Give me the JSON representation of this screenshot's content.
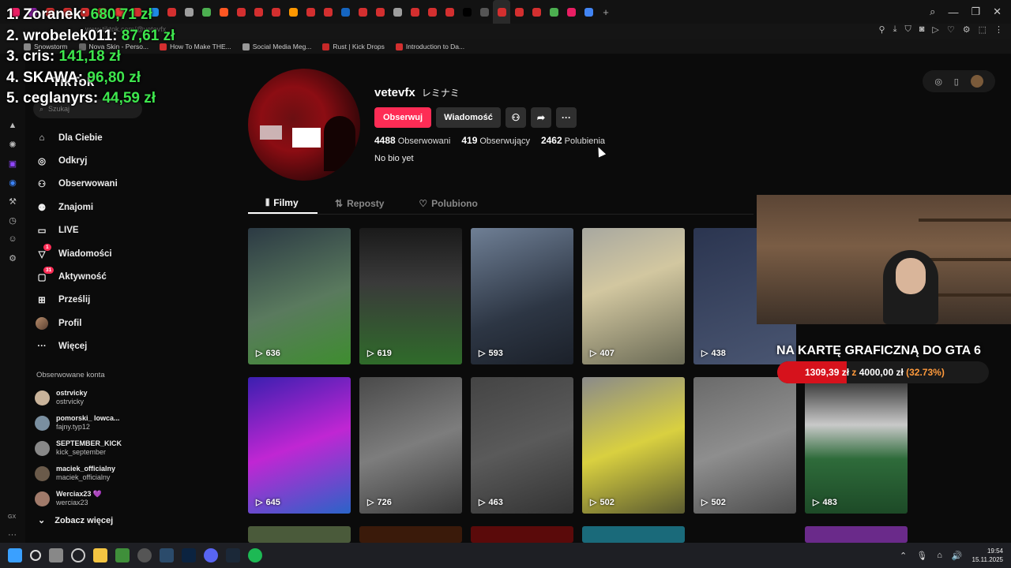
{
  "browser": {
    "url": "www.tiktok.com/@vetevfx",
    "tab_icon_colors": [
      "#e91e63",
      "#8e24aa",
      "#d32f2f",
      "#d32f2f",
      "#d32f2f",
      "#e53935",
      "#e53935",
      "#d32f2f",
      "#1e88e5",
      "#d32f2f",
      "#9e9e9e",
      "#4caf50",
      "#ff5722",
      "#d32f2f",
      "#d32f2f",
      "#d32f2f",
      "#ff9800",
      "#d32f2f",
      "#d32f2f",
      "#1565c0",
      "#d32f2f",
      "#d32f2f",
      "#9e9e9e",
      "#d32f2f",
      "#d32f2f",
      "#d32f2f",
      "#000000",
      "#555555",
      "#d32f2f",
      "#d32f2f",
      "#d32f2f",
      "#4caf50",
      "#e91e63",
      "#4285f4"
    ],
    "bookmarks": [
      {
        "label": "Snowstorm",
        "color": "#888888"
      },
      {
        "label": "Nova Skin - Perso...",
        "color": "#666666"
      },
      {
        "label": "How To Make THE...",
        "color": "#d32f2f"
      },
      {
        "label": "Social Media Meg...",
        "color": "#999999"
      },
      {
        "label": "Rust | Kick Drops",
        "color": "#c62828"
      },
      {
        "label": "Introduction to Da...",
        "color": "#d32f2f"
      }
    ]
  },
  "leaderboard": [
    {
      "rank_name": "1. Zoranek:",
      "amount": "680,71 zł"
    },
    {
      "rank_name": "2. wrobelek011:",
      "amount": "87,61 zł"
    },
    {
      "rank_name": "3. cris:",
      "amount": "141,18 zł"
    },
    {
      "rank_name": "4. SKAWA:",
      "amount": "96,80 zł"
    },
    {
      "rank_name": "5. ceglanyrs:",
      "amount": "44,59 zł"
    }
  ],
  "tiktok": {
    "logo": "TikTok",
    "search_placeholder": "Szukaj",
    "nav": [
      {
        "label": "Dla Ciebie",
        "icon": "home-icon"
      },
      {
        "label": "Odkryj",
        "icon": "compass-icon"
      },
      {
        "label": "Obserwowani",
        "icon": "following-icon"
      },
      {
        "label": "Znajomi",
        "icon": "friends-icon"
      },
      {
        "label": "LIVE",
        "icon": "live-icon"
      },
      {
        "label": "Wiadomości",
        "icon": "messages-icon",
        "badge": "1"
      },
      {
        "label": "Aktywność",
        "icon": "activity-icon",
        "badge": "31"
      },
      {
        "label": "Prześlij",
        "icon": "upload-icon"
      },
      {
        "label": "Profil",
        "icon": "profile-icon"
      },
      {
        "label": "Więcej",
        "icon": "more-icon"
      }
    ],
    "followed_title": "Obserwowane konta",
    "followed": [
      {
        "name": "ostrvicky",
        "handle": "ostrvicky"
      },
      {
        "name": "pomorski_ lowca...",
        "handle": "fajny.typ12"
      },
      {
        "name": "SEPTEMBER_KICK",
        "handle": "kick_september"
      },
      {
        "name": "maciek_officialny",
        "handle": "maciek_officialny"
      },
      {
        "name": "Werciax23 💜",
        "handle": "werciax23"
      }
    ],
    "see_more": "Zobacz więcej"
  },
  "profile": {
    "username": "vetevfx",
    "nickname": "レミナミ",
    "follow_button": "Obserwuj",
    "message_button": "Wiadomość",
    "stats": [
      {
        "value": "4488",
        "label": "Obserwowani"
      },
      {
        "value": "419",
        "label": "Obserwujący"
      },
      {
        "value": "2462",
        "label": "Polubienia"
      }
    ],
    "bio": "No bio yet",
    "tabs": [
      {
        "label": "Filmy",
        "icon": "grid-icon"
      },
      {
        "label": "Reposty",
        "icon": "repost-icon"
      },
      {
        "label": "Polubiono",
        "icon": "heart-icon"
      }
    ]
  },
  "videos": [
    {
      "views": "636",
      "bg": "linear-gradient(160deg,#2c3a44 0%,#5a7a5e 55%,#3e8d2f 100%)"
    },
    {
      "views": "619",
      "bg": "linear-gradient(180deg,#1a1a1a 0%,#3a3a3a 40%,#2f6b2a 100%)"
    },
    {
      "views": "593",
      "bg": "linear-gradient(160deg,#6f7f95 0%,#2d3644 60%,#1b2029 100%)"
    },
    {
      "views": "407",
      "bg": "linear-gradient(160deg,#a8a8a0 0%,#d2c7a0 40%,#6a6a55 100%)"
    },
    {
      "views": "438",
      "bg": "linear-gradient(160deg,#2b3550 0%,#4a5672 100%)"
    },
    {
      "views": "645",
      "bg": "linear-gradient(160deg,#3b1fb0 0%,#c026d3 50%,#2a64c8 100%)"
    },
    {
      "views": "726",
      "bg": "linear-gradient(160deg,#4a4a4a 0%,#7d7d7d 50%,#3a3a3a 100%)"
    },
    {
      "views": "463",
      "bg": "linear-gradient(160deg,#444 0%,#5a5a5a 50%,#333 100%)"
    },
    {
      "views": "502",
      "bg": "linear-gradient(160deg,#8a8a8a 0%,#d9d040 50%,#5a5a30 100%)"
    },
    {
      "views": "502",
      "bg": "linear-gradient(160deg,#6a6a6a 0%,#8e8e8e 50%,#4d4d4d 100%)"
    },
    {
      "views": "483",
      "bg": "linear-gradient(180deg,#2a2a2a 0%,#c9c9c9 35%,#2e6b3a 60%,#1d4a27 100%)"
    }
  ],
  "donation": {
    "title": "NA KARTĘ GRAFICZNĄ DO GTA 6",
    "current": "1309,39 zł",
    "of": "z",
    "goal": "4000,00 zł",
    "percent_label": "(32.73%)",
    "progress": 0.3273
  },
  "clock": {
    "time": "19:54",
    "date": "15.11.2025"
  },
  "rail_label": "GX"
}
